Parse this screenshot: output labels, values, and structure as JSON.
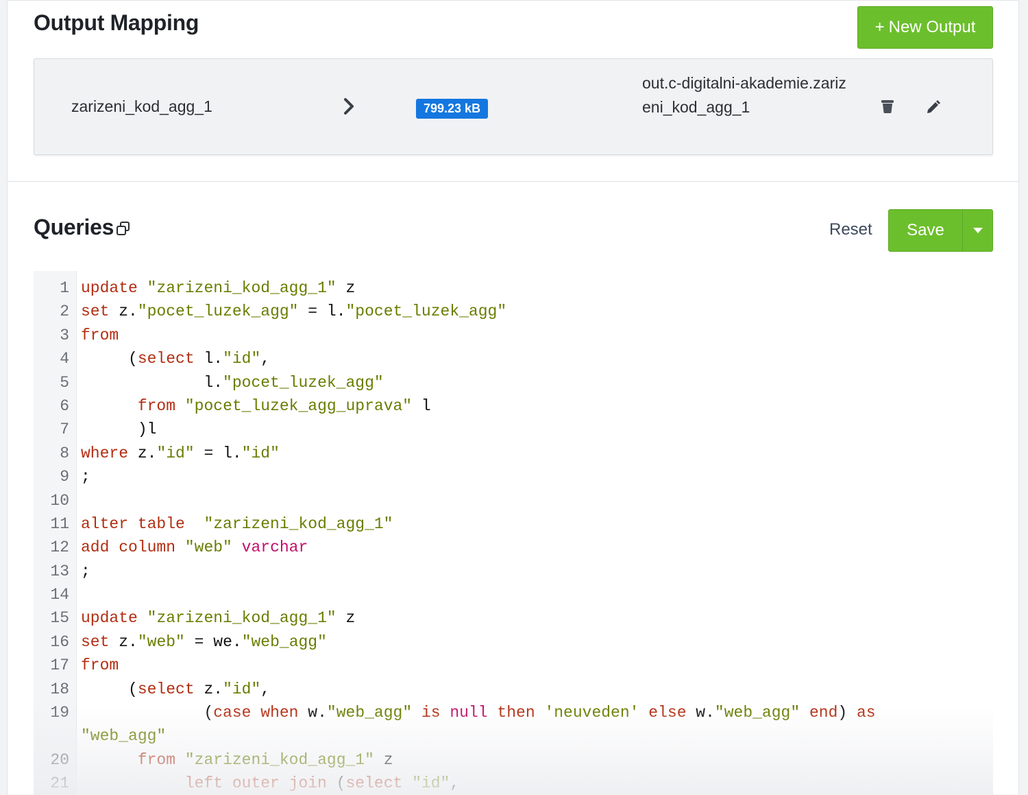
{
  "output_mapping": {
    "title": "Output Mapping",
    "new_output_label": "New Output",
    "new_output_plus": "+",
    "row": {
      "source": "zarizeni_kod_agg_1",
      "size": "799.23 kB",
      "destination": "out.c-digitalni-akademie.zarizeni_kod_agg_1"
    }
  },
  "queries": {
    "title": "Queries",
    "reset_label": "Reset",
    "save_label": "Save"
  },
  "colors": {
    "accent_green": "#6cbf2c",
    "badge_blue": "#1477e0",
    "keyword": "#b22e12",
    "string": "#6a7d00",
    "type": "#c10f6b"
  },
  "code_lines": [
    {
      "n": "1",
      "t": [
        [
          "kw",
          "update"
        ],
        [
          "p",
          " "
        ],
        [
          "str",
          "\"zarizeni_kod_agg_1\""
        ],
        [
          "p",
          " z"
        ]
      ]
    },
    {
      "n": "2",
      "t": [
        [
          "kw",
          "set"
        ],
        [
          "p",
          " z."
        ],
        [
          "str",
          "\"pocet_luzek_agg\""
        ],
        [
          "p",
          " = l."
        ],
        [
          "str",
          "\"pocet_luzek_agg\""
        ]
      ]
    },
    {
      "n": "3",
      "t": [
        [
          "kw",
          "from"
        ]
      ]
    },
    {
      "n": "4",
      "t": [
        [
          "p",
          "     ("
        ],
        [
          "kw",
          "select"
        ],
        [
          "p",
          " l."
        ],
        [
          "str",
          "\"id\""
        ],
        [
          "p",
          ","
        ]
      ]
    },
    {
      "n": "5",
      "t": [
        [
          "p",
          "             l."
        ],
        [
          "str",
          "\"pocet_luzek_agg\""
        ]
      ]
    },
    {
      "n": "6",
      "t": [
        [
          "p",
          "      "
        ],
        [
          "kw",
          "from"
        ],
        [
          "p",
          " "
        ],
        [
          "str",
          "\"pocet_luzek_agg_uprava\""
        ],
        [
          "p",
          " l"
        ]
      ]
    },
    {
      "n": "7",
      "t": [
        [
          "p",
          "      )l"
        ]
      ]
    },
    {
      "n": "8",
      "t": [
        [
          "kw",
          "where"
        ],
        [
          "p",
          " z."
        ],
        [
          "str",
          "\"id\""
        ],
        [
          "p",
          " = l."
        ],
        [
          "str",
          "\"id\""
        ]
      ]
    },
    {
      "n": "9",
      "t": [
        [
          "p",
          ";"
        ]
      ]
    },
    {
      "n": "10",
      "t": []
    },
    {
      "n": "11",
      "t": [
        [
          "kw",
          "alter table"
        ],
        [
          "p",
          "  "
        ],
        [
          "str",
          "\"zarizeni_kod_agg_1\""
        ]
      ]
    },
    {
      "n": "12",
      "t": [
        [
          "kw",
          "add column"
        ],
        [
          "p",
          " "
        ],
        [
          "str",
          "\"web\""
        ],
        [
          "p",
          " "
        ],
        [
          "ty",
          "varchar"
        ]
      ]
    },
    {
      "n": "13",
      "t": [
        [
          "p",
          ";"
        ]
      ]
    },
    {
      "n": "14",
      "t": []
    },
    {
      "n": "15",
      "t": [
        [
          "kw",
          "update"
        ],
        [
          "p",
          " "
        ],
        [
          "str",
          "\"zarizeni_kod_agg_1\""
        ],
        [
          "p",
          " z"
        ]
      ]
    },
    {
      "n": "16",
      "t": [
        [
          "kw",
          "set"
        ],
        [
          "p",
          " z."
        ],
        [
          "str",
          "\"web\""
        ],
        [
          "p",
          " = we."
        ],
        [
          "str",
          "\"web_agg\""
        ]
      ]
    },
    {
      "n": "17",
      "t": [
        [
          "kw",
          "from"
        ]
      ]
    },
    {
      "n": "18",
      "t": [
        [
          "p",
          "     ("
        ],
        [
          "kw",
          "select"
        ],
        [
          "p",
          " z."
        ],
        [
          "str",
          "\"id\""
        ],
        [
          "p",
          ","
        ]
      ]
    },
    {
      "n": "19",
      "t": [
        [
          "p",
          "             ("
        ],
        [
          "kw",
          "case when"
        ],
        [
          "p",
          " w."
        ],
        [
          "str",
          "\"web_agg\""
        ],
        [
          "p",
          " "
        ],
        [
          "kw",
          "is"
        ],
        [
          "p",
          " "
        ],
        [
          "ty",
          "null"
        ],
        [
          "p",
          " "
        ],
        [
          "kw",
          "then"
        ],
        [
          "p",
          " "
        ],
        [
          "str",
          "'neuveden'"
        ],
        [
          "p",
          " "
        ],
        [
          "kw",
          "else"
        ],
        [
          "p",
          " w."
        ],
        [
          "str",
          "\"web_agg\""
        ],
        [
          "p",
          " "
        ],
        [
          "kw",
          "end"
        ],
        [
          "p",
          ") "
        ],
        [
          "kw",
          "as"
        ],
        [
          "p",
          "\n"
        ],
        [
          "str",
          "\"web_agg\""
        ]
      ],
      "tall": true
    },
    {
      "n": "20",
      "t": [
        [
          "p",
          "      "
        ],
        [
          "kw",
          "from"
        ],
        [
          "p",
          " "
        ],
        [
          "str",
          "\"zarizeni_kod_agg_1\""
        ],
        [
          "p",
          " z"
        ]
      ]
    },
    {
      "n": "21",
      "t": [
        [
          "p",
          "           "
        ],
        [
          "kw",
          "left outer join"
        ],
        [
          "p",
          " ("
        ],
        [
          "kw",
          "select"
        ],
        [
          "p",
          " "
        ],
        [
          "str",
          "\"id\""
        ],
        [
          "p",
          ","
        ]
      ]
    }
  ]
}
